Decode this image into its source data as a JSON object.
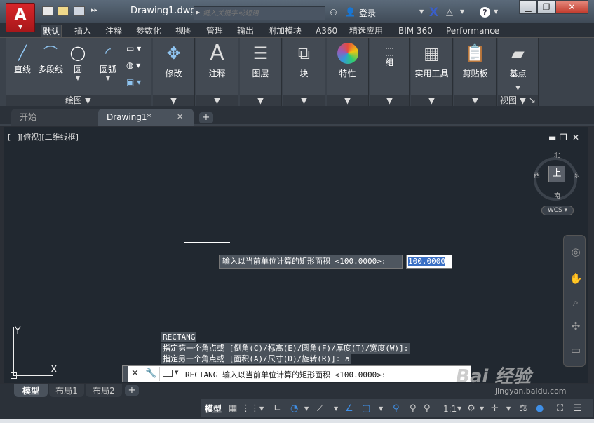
{
  "window": {
    "title": "Drawing1.dwg",
    "app_logo": "A",
    "minimize": "▁",
    "restore": "❐",
    "close": "✕",
    "search_placeholder": "键入关键字或短语",
    "login": "登录"
  },
  "ribbon_tabs": [
    "默认",
    "插入",
    "注释",
    "参数化",
    "视图",
    "管理",
    "输出",
    "附加模块",
    "A360",
    "精选应用",
    "BIM 360",
    "Performance"
  ],
  "ribbon": {
    "draw_tools": [
      {
        "label": "直线",
        "icon": "line-icon"
      },
      {
        "label": "多段线",
        "icon": "polyline-icon"
      },
      {
        "label": "圆",
        "icon": "circle-icon"
      },
      {
        "label": "圆弧",
        "icon": "arc-icon"
      }
    ],
    "draw_panel_title": "绘图",
    "panels": [
      {
        "label": "修改",
        "icon": "modify-icon"
      },
      {
        "label": "注释",
        "icon": "annotation-icon"
      },
      {
        "label": "图层",
        "icon": "layers-icon"
      },
      {
        "label": "块",
        "icon": "block-icon"
      },
      {
        "label": "特性",
        "icon": "properties-icon"
      },
      {
        "label": "组",
        "icon": "group-icon"
      },
      {
        "label": "实用工具",
        "icon": "utilities-icon"
      },
      {
        "label": "剪贴板",
        "icon": "clipboard-icon"
      },
      {
        "label": "基点",
        "icon": "basepoint-icon"
      }
    ],
    "view_panel_title": "视图"
  },
  "file_tabs": {
    "start": "开始",
    "drawing": "Drawing1*"
  },
  "viewport": {
    "label": "[−][俯视][二维线框]",
    "cube_top": "上",
    "north": "北",
    "south": "南",
    "east": "东",
    "west": "西",
    "wcs": "WCS",
    "prompt": "输入以当前单位计算的矩形面积 <100.0000>:",
    "prompt_value": "100.0000",
    "ucs_x": "X",
    "ucs_y": "Y"
  },
  "command_history": [
    "RECTANG",
    "指定第一个角点或 [倒角(C)/标高(E)/圆角(F)/厚度(T)/宽度(W)]:",
    "指定另一个角点或 [面积(A)/尺寸(D)/旋转(R)]: a"
  ],
  "command_line": {
    "text": "RECTANG 输入以当前单位计算的矩形面积 <100.0000>:"
  },
  "layout_tabs": [
    "模型",
    "布局1",
    "布局2"
  ],
  "status": {
    "model": "模型",
    "scale": "1:1"
  },
  "watermark": {
    "brand": "Bai 经验",
    "url": "jingyan.baidu.com"
  }
}
